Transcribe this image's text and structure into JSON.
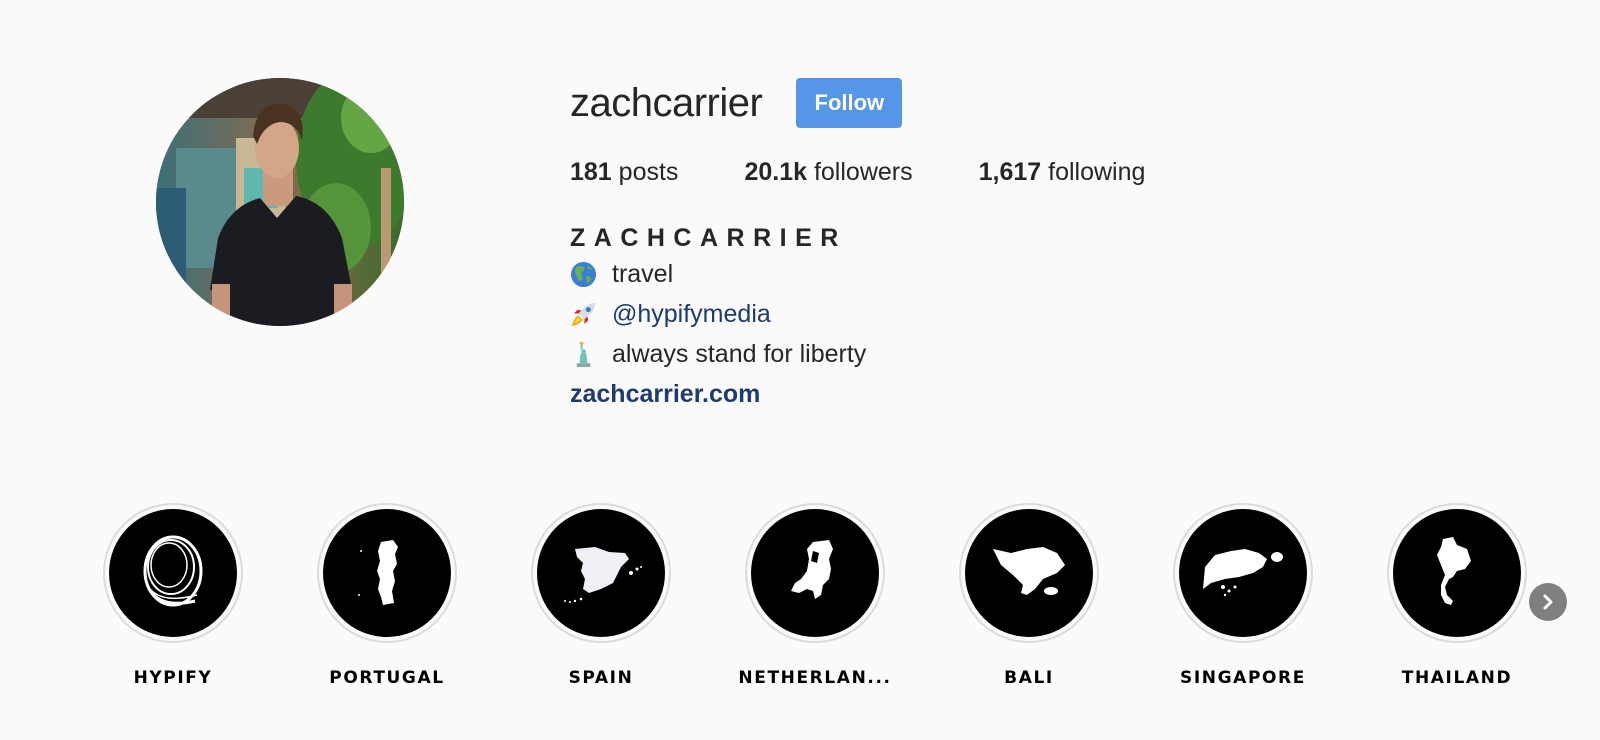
{
  "profile": {
    "username": "zachcarrier",
    "follow_label": "Follow",
    "accent_color": "#5596e6",
    "avatar_alt": "Profile photo of a man in a black v-neck t-shirt looking up, with green plants behind him",
    "stats": [
      {
        "count": "181",
        "label": "posts"
      },
      {
        "count": "20.1k",
        "label": "followers"
      },
      {
        "count": "1,617",
        "label": "following"
      }
    ],
    "full_name": "ZACHCARRIER",
    "bio": [
      {
        "emoji": "🌎",
        "icon": "globe-americas-icon",
        "text": "travel",
        "is_link": false
      },
      {
        "emoji": "🚀",
        "icon": "rocket-icon",
        "text": "@hypifymedia",
        "is_link": true
      },
      {
        "emoji": "🗽",
        "icon": "statue-of-liberty-icon",
        "text": "always stand for liberty",
        "is_link": false
      }
    ],
    "website": "zachcarrier.com",
    "link_color": "#1e3a6e"
  },
  "highlights": [
    {
      "label": "HYPIFY",
      "icon": "astronaut-helmet-icon"
    },
    {
      "label": "PORTUGAL",
      "icon": "portugal-map-icon"
    },
    {
      "label": "SPAIN",
      "icon": "spain-map-icon"
    },
    {
      "label": "NETHERLAN...",
      "icon": "netherlands-map-icon"
    },
    {
      "label": "BALI",
      "icon": "bali-map-icon"
    },
    {
      "label": "SINGAPORE",
      "icon": "singapore-map-icon"
    },
    {
      "label": "THAILAND",
      "icon": "thailand-map-icon"
    }
  ],
  "highlights_next": {
    "icon": "chevron-right-icon"
  }
}
